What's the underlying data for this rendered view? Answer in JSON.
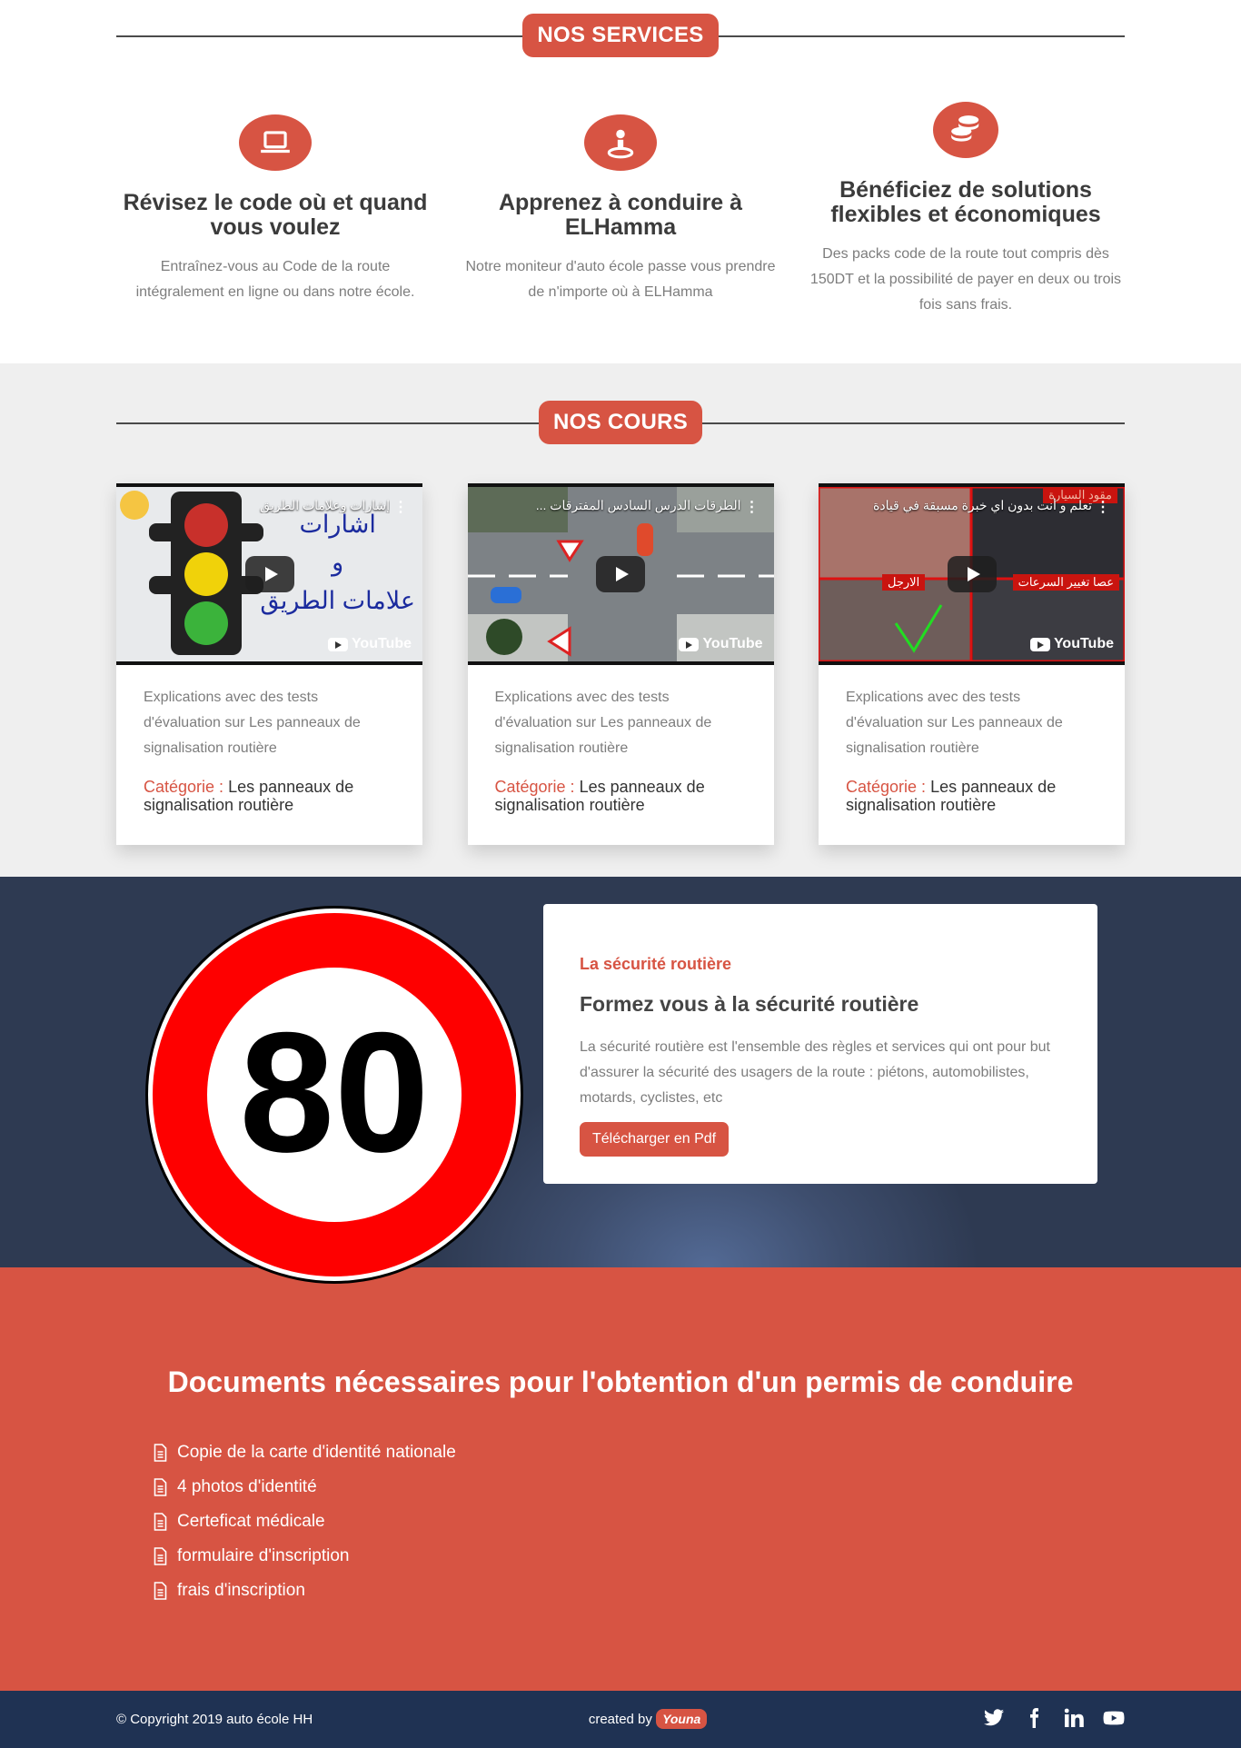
{
  "services": {
    "heading": "NOS SERVICES",
    "items": [
      {
        "icon": "laptop-icon",
        "title": "Révisez le code où et quand vous voulez",
        "text": "Entraînez-vous au Code de la route intégralement en ligne ou dans notre école."
      },
      {
        "icon": "driver-icon",
        "title": "Apprenez à conduire à ELHamma",
        "text": "Notre moniteur d'auto école passe vous prendre de n'importe où à ELHamma"
      },
      {
        "icon": "coins-icon",
        "title": "Bénéficiez de solutions flexibles et économiques",
        "text": "Des packs code de la route tout compris dès 150DT et la possibilité de payer en deux ou trois fois sans frais."
      }
    ]
  },
  "courses": {
    "heading": "NOS COURS",
    "items": [
      {
        "video_title": "إشارات وعلامات الطريق",
        "overlay_lines": [
          "اشارات",
          "و",
          "علامات الطريق"
        ],
        "desc": "Explications avec des tests d'évaluation sur Les panneaux de signalisation routière",
        "cat_label": "Catégorie :",
        "cat_value": "Les panneaux de signalisation routière"
      },
      {
        "video_title": "الطرقات الدرس السادس المفترقات ...",
        "desc": "Explications avec des tests d'évaluation sur Les panneaux de signalisation routière",
        "cat_label": "Catégorie :",
        "cat_value": "Les panneaux de signalisation routière"
      },
      {
        "video_title": "تعلم و أنت بدون اي خبرة مسبقة في قيادة السيارة",
        "overlay_lines": [
          "مقود السيارة",
          "عصا تغيير السرعات",
          "الارجل"
        ],
        "desc": "Explications avec des tests d'évaluation sur Les panneaux de signalisation routière",
        "cat_label": "Catégorie :",
        "cat_value": "Les panneaux de signalisation routière"
      }
    ],
    "youtube_label": "YouTube"
  },
  "safety": {
    "sign_value": "80",
    "kicker": "La sécurité routière",
    "title": "Formez vous à la sécurité routière",
    "text": "La sécurité routière est l'ensemble des règles et services qui ont pour but d'assurer la sécurité des usagers de la route : piétons, automobilistes, motards, cyclistes, etc",
    "button": "Télécharger en Pdf"
  },
  "documents": {
    "title": "Documents nécessaires pour l'obtention d'un permis de conduire",
    "items": [
      "Copie de la carte d'identité nationale",
      "4 photos d'identité",
      "Certeficat médicale",
      "formulaire d'inscription",
      "frais d'inscription"
    ]
  },
  "footer": {
    "copyright": "© Copyright 2019 auto école HH",
    "created_by": "created by",
    "brand": "Youna",
    "socials": [
      "twitter-icon",
      "facebook-icon",
      "linkedin-icon",
      "youtube-icon"
    ]
  },
  "colors": {
    "accent": "#d75443",
    "dark": "#1f3253",
    "grey_bg": "#efefef"
  }
}
